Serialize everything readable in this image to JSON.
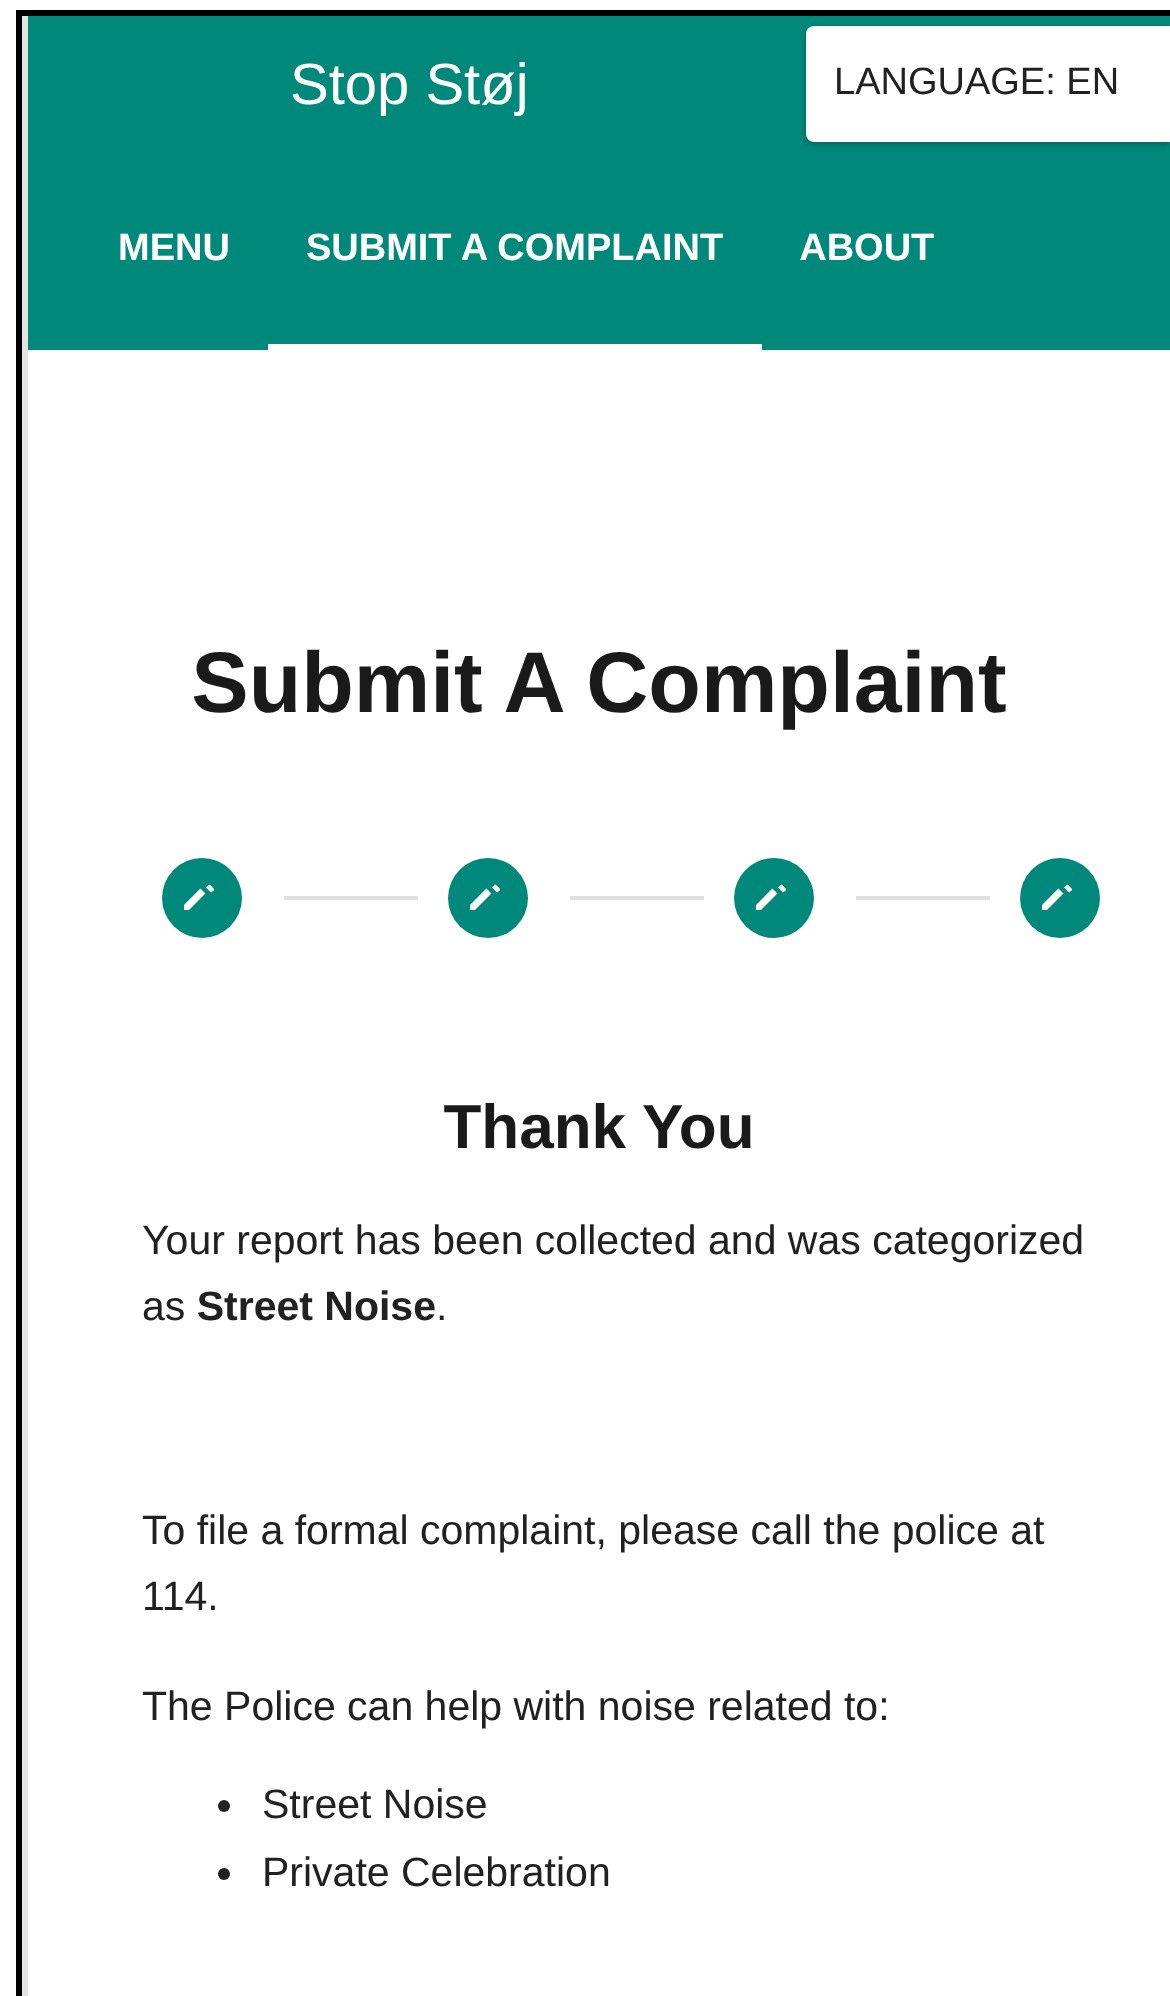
{
  "header": {
    "title": "Stop Støj",
    "language_button": "LANGUAGE: EN"
  },
  "tabs": [
    {
      "label": "MENU",
      "selected": false
    },
    {
      "label": "SUBMIT A COMPLAINT",
      "selected": true
    },
    {
      "label": "ABOUT",
      "selected": false
    }
  ],
  "page_title": "Submit A Complaint",
  "steps": [
    {
      "kind": "edit"
    },
    {
      "kind": "edit"
    },
    {
      "kind": "edit"
    },
    {
      "kind": "edit"
    }
  ],
  "heading": "Thank You",
  "paragraphs": [
    "Your report has been collected and was categorized as **Street Noise**.",
    "To file a formal complaint, please call the police at 114.",
    "The Police can help with noise related to:"
  ],
  "list": [
    "Street Noise",
    "Private Celebration"
  ]
}
